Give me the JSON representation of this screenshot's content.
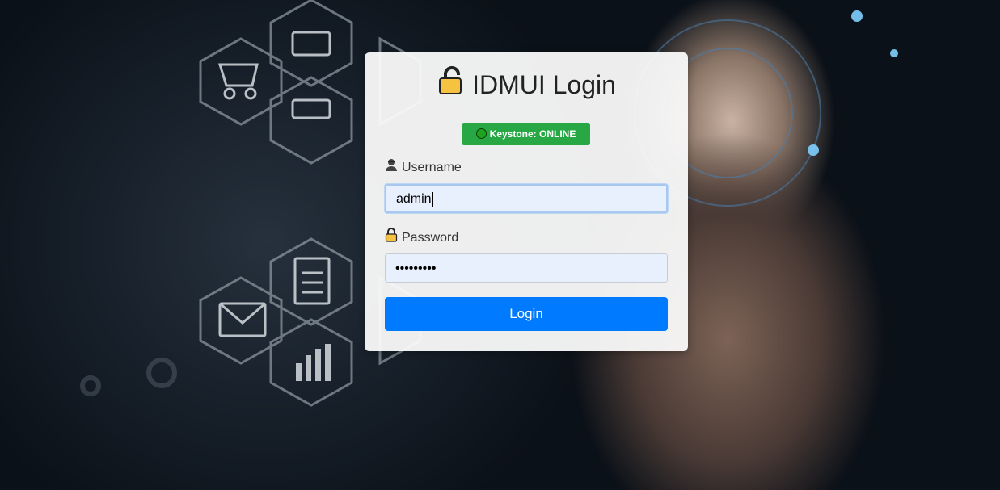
{
  "page": {
    "title": "IDMUI Login",
    "lock_icon": "lock-icon"
  },
  "status": {
    "label": "Keystone: ONLINE",
    "color": "#28a745"
  },
  "form": {
    "username_label": "Username",
    "username_value": "admin",
    "password_label": "Password",
    "password_value": "•••••••••",
    "login_label": "Login"
  },
  "colors": {
    "button": "#007bff",
    "input_bg": "#e8f0fe"
  }
}
